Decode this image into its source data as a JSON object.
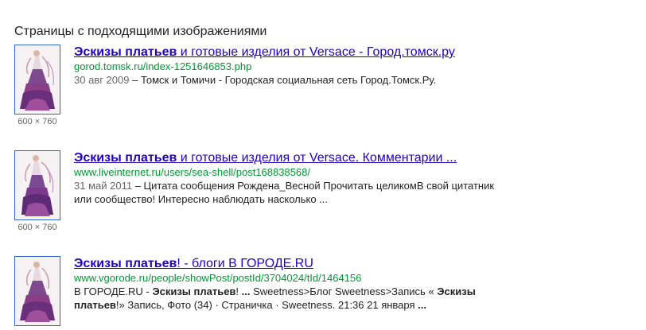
{
  "section": {
    "heading": "Страницы с подходящими изображениями"
  },
  "results": [
    {
      "title_bold": "Эскизы платьев",
      "title_rest": " и готовые изделия от Versace - Город.томск.ру",
      "url": "gorod.tomsk.ru/index-1251646853.php",
      "date": "30 авг 2009",
      "snippet": " – Томск и Томичи - Городская социальная сеть Город.Томск.Ру.",
      "dims": "600 × 760",
      "thumb_icon": "dress-sketch-thumbnail"
    },
    {
      "title_bold": "Эскизы платьев",
      "title_rest": " и готовые изделия от Versace. Комментарии ...",
      "url": "www.liveinternet.ru/users/sea-shell/post168838568/",
      "date": "31 май 2011",
      "snippet": " – Цитата сообщения Рождена_Весной Прочитать целикомВ свой цитатник или сообщество! Интересно наблюдать насколько ...",
      "dims": "600 × 760",
      "thumb_icon": "dress-sketch-thumbnail"
    },
    {
      "title_bold": "Эскизы платьев",
      "title_rest": "! - блоги В ГОРОДЕ.RU",
      "url": "www.vgorode.ru/people/showPost/postId/3704024/tId/1464156",
      "snippet_parts": [
        {
          "text": "В ГОРОДЕ.RU - ",
          "bold": false
        },
        {
          "text": "Эскизы платьев",
          "bold": true
        },
        {
          "text": "! ",
          "bold": false
        },
        {
          "text": "...",
          "bold": true
        },
        {
          "text": " Sweetness>Блог Sweetness>Запись « ",
          "bold": false
        },
        {
          "text": "Эскизы платьев",
          "bold": true
        },
        {
          "text": "!» Запись, Фото (34) · Страничка · Sweetness. 21:36 21 января ",
          "bold": false
        },
        {
          "text": "...",
          "bold": true
        }
      ],
      "thumb_icon": "dress-sketch-thumbnail"
    }
  ],
  "colors": {
    "link": "#2200c1",
    "url": "#009933",
    "text": "#222222",
    "meta": "#666666",
    "thumb_border": "#3366cc"
  }
}
